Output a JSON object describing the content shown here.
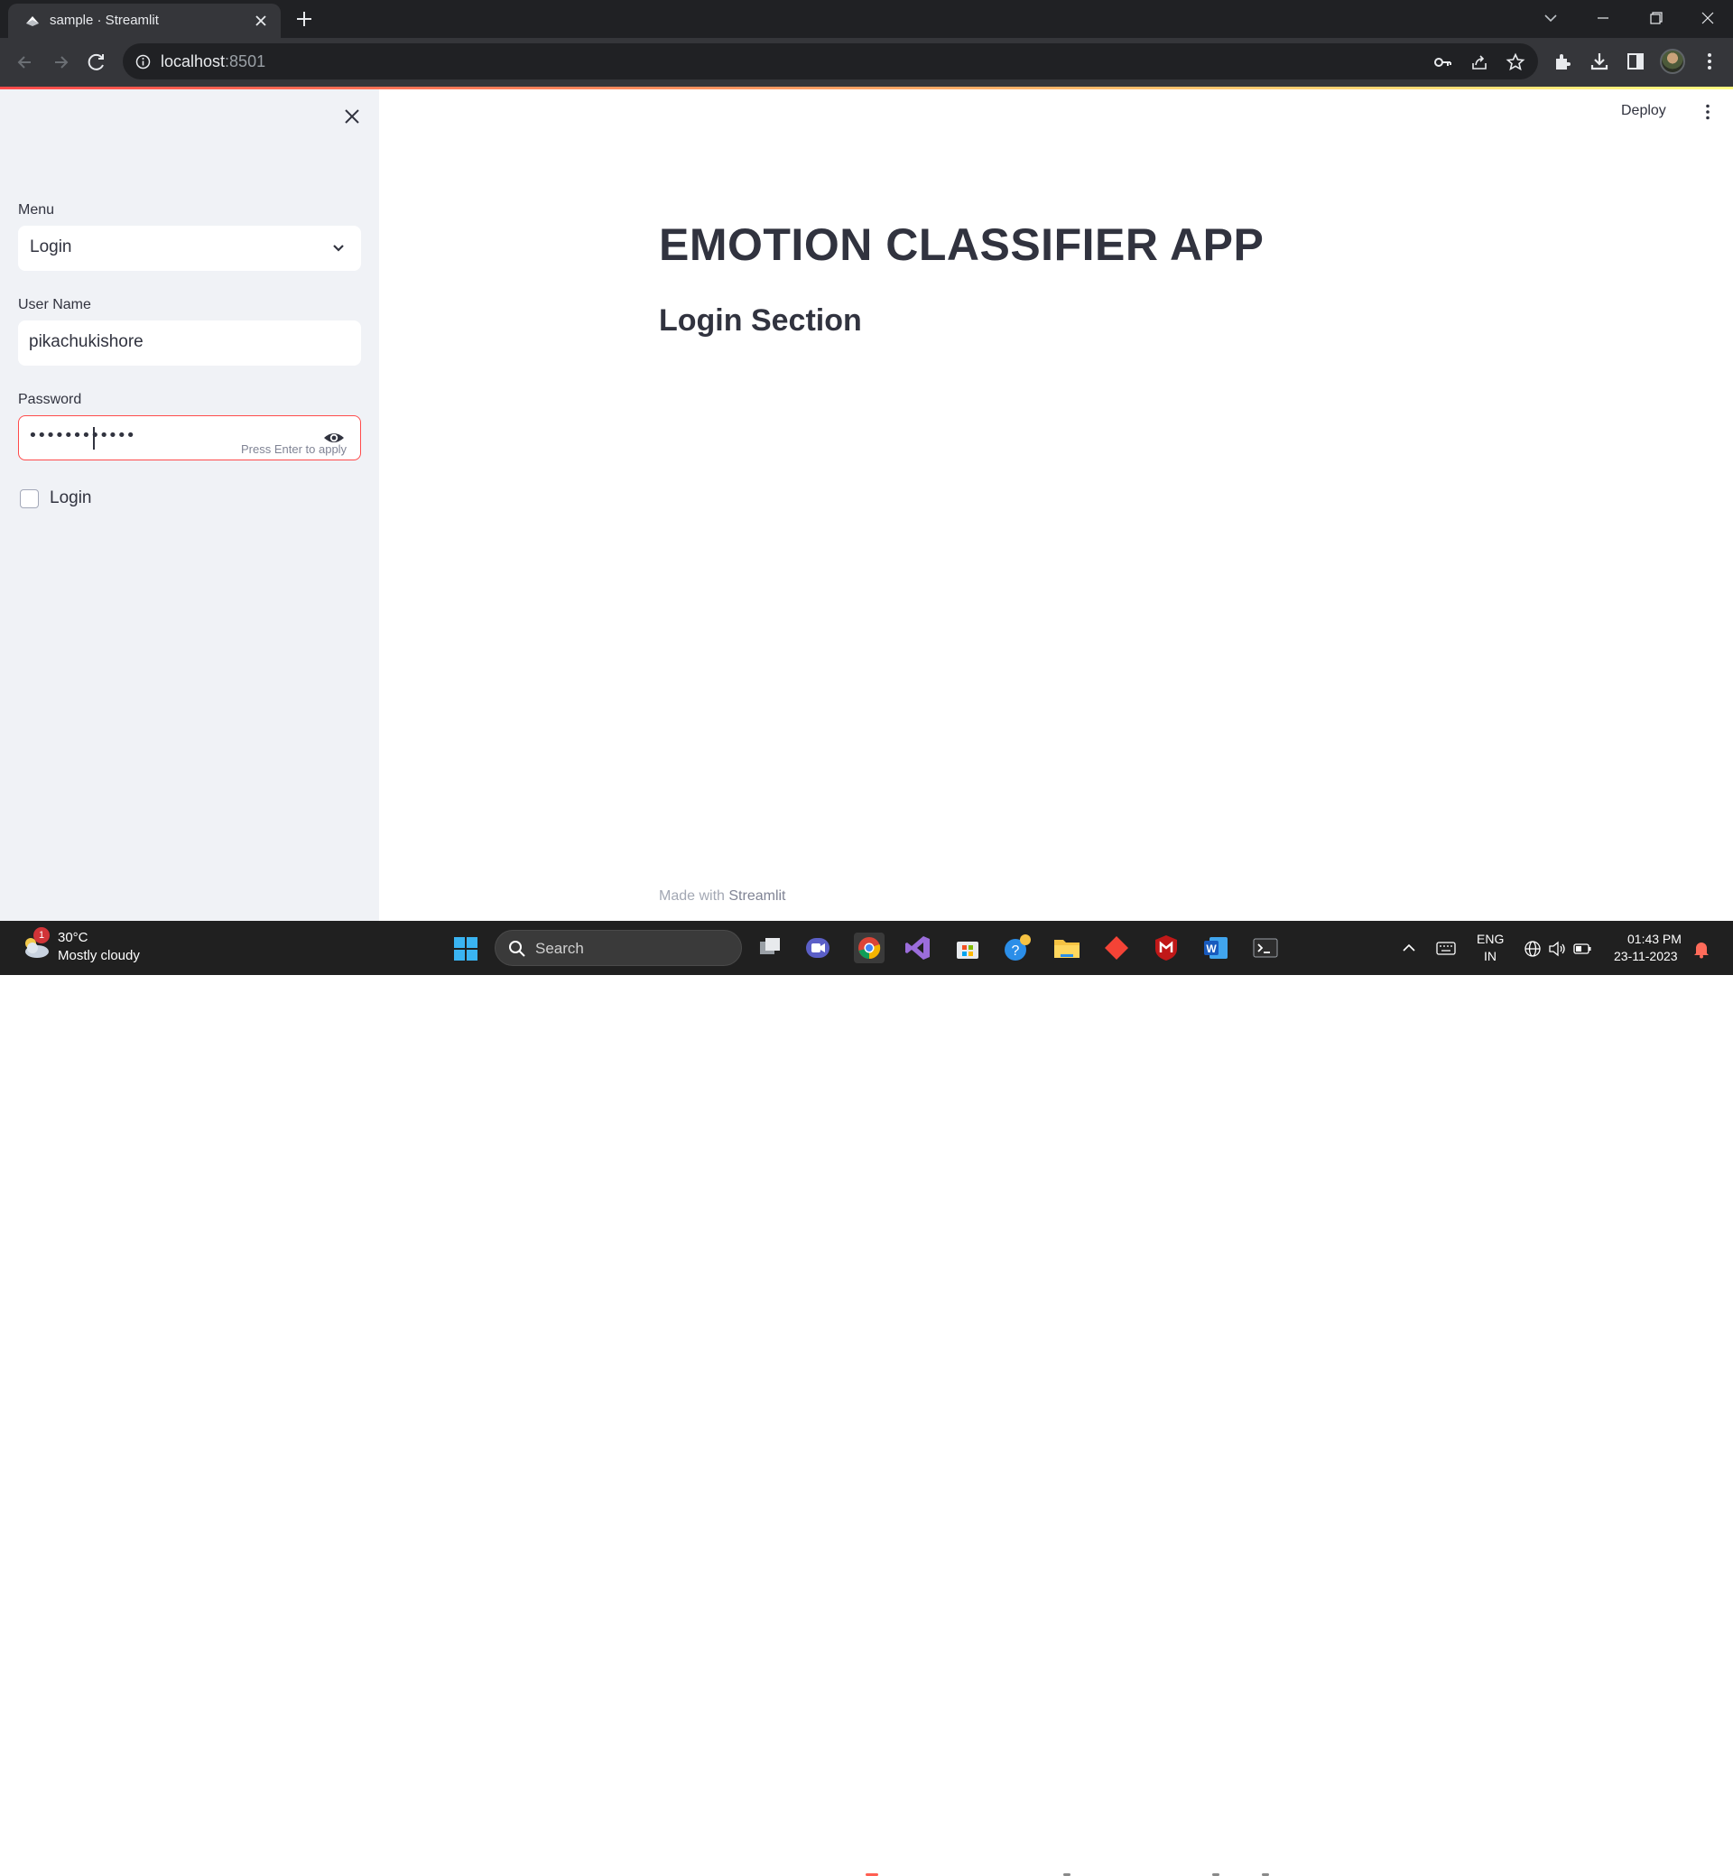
{
  "browser": {
    "tab_title": "sample · Streamlit",
    "url_host": "localhost",
    "url_port": ":8501"
  },
  "sidebar": {
    "menu_label": "Menu",
    "menu_selected": "Login",
    "username_label": "User Name",
    "username_value": "pikachukishore",
    "password_label": "Password",
    "password_value": "••••••••••••",
    "password_hint": "Press Enter to apply",
    "checkbox_label": "Login"
  },
  "header": {
    "deploy_label": "Deploy"
  },
  "main": {
    "title": "EMOTION CLASSIFIER APP",
    "subtitle": "Login Section",
    "footer_prefix": "Made with ",
    "footer_brand": "Streamlit"
  },
  "taskbar": {
    "weather_badge": "1",
    "weather_temp": "30°C",
    "weather_desc": "Mostly cloudy",
    "search_label": "Search",
    "lang_top": "ENG",
    "lang_bottom": "IN",
    "time": "01:43 PM",
    "date": "23-11-2023"
  },
  "colors": {
    "accent": "#ff4b4b",
    "sidebar_bg": "#f0f2f6",
    "text": "#31333f"
  }
}
